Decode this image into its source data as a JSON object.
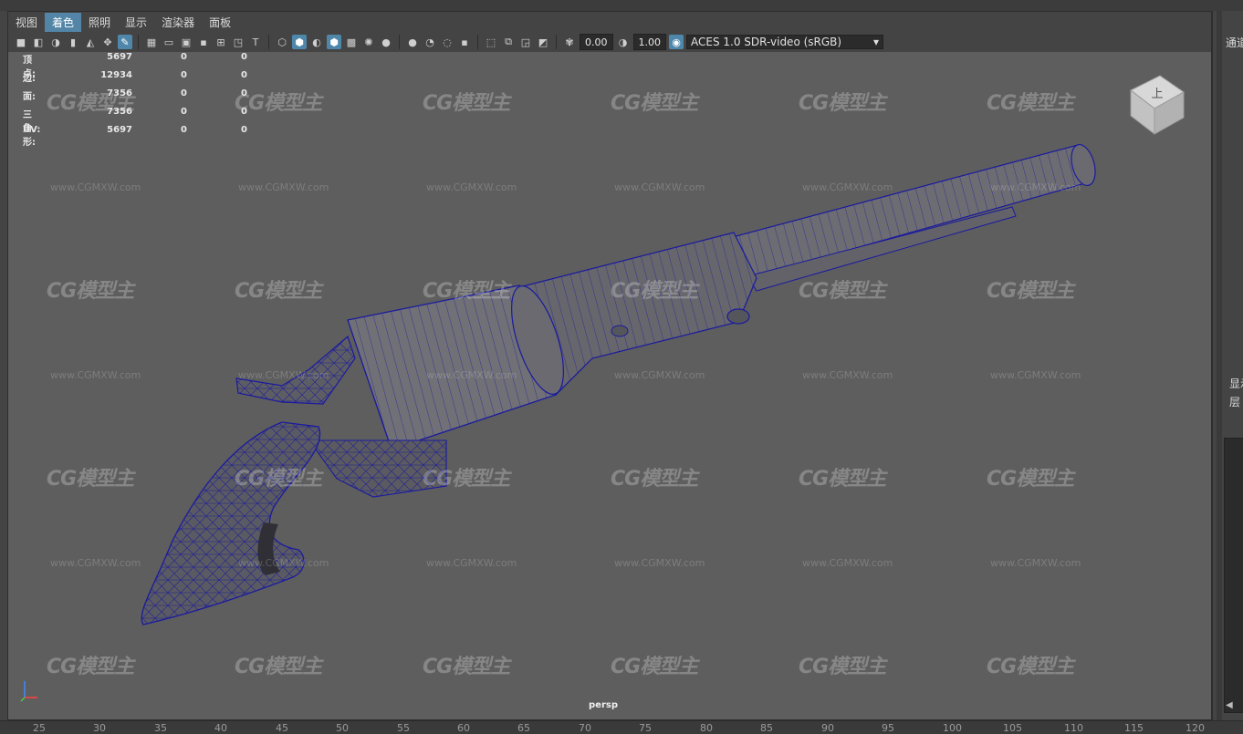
{
  "menu": [
    "视图",
    "着色",
    "照明",
    "显示",
    "渲染器",
    "面板"
  ],
  "menu_active_index": 1,
  "toolbar": {
    "exposure_value": "0.00",
    "gamma_value": "1.00",
    "color_space": "ACES 1.0 SDR-video (sRGB)"
  },
  "hud_stats": [
    {
      "label": "顶点:",
      "v1": "5697",
      "v2": "0",
      "v3": "0"
    },
    {
      "label": "边:",
      "v1": "12934",
      "v2": "0",
      "v3": "0"
    },
    {
      "label": "面:",
      "v1": "7356",
      "v2": "0",
      "v3": "0"
    },
    {
      "label": "三角形:",
      "v1": "7356",
      "v2": "0",
      "v3": "0"
    },
    {
      "label": "UV:",
      "v1": "5697",
      "v2": "0",
      "v3": "0"
    }
  ],
  "camera_label": "persp",
  "viewcube_label": "上",
  "watermark": {
    "logo": "CG模型主",
    "url": "www.CGMXW.com"
  },
  "ruler_ticks": [
    "25",
    "30",
    "35",
    "40",
    "45",
    "50",
    "55",
    "60",
    "65",
    "70",
    "75",
    "80",
    "85",
    "90",
    "95",
    "100",
    "105",
    "110",
    "115",
    "120"
  ],
  "right_panel": {
    "channels": "通道",
    "display": "显示",
    "layers": "层"
  },
  "colors": {
    "accent": "#5285a6",
    "viewport_bg": "#5e5e5e",
    "wireframe": "#1a1aa0"
  }
}
